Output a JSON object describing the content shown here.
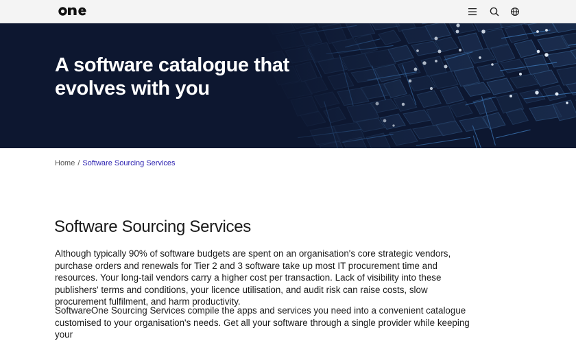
{
  "header": {
    "logo_text": "one",
    "icons": [
      "menu-icon",
      "search-icon",
      "globe-icon"
    ]
  },
  "hero": {
    "title": "A software catalogue that evolves with you"
  },
  "breadcrumb": {
    "home": "Home",
    "separator": "/",
    "current": "Software Sourcing Services"
  },
  "main": {
    "title": "Software Sourcing Services",
    "paragraphs": [
      "Although typically 90% of software budgets are spent on an organisation's core strategic vendors, purchase orders and renewals for Tier 2 and 3 software take up most IT procurement time and resources. Your long-tail vendors carry a higher cost per transaction. Lack of visibility into these publishers' terms and conditions, your licence utilisation, and audit risk can raise costs, slow procurement fulfilment, and harm productivity.",
      "SoftwareOne Sourcing Services compile the apps and services you need into a convenient catalogue customised to your organisation's needs. Get all your software through a single provider while keeping your"
    ]
  },
  "colors": {
    "hero_bg": "#0d1730",
    "breadcrumb_active": "#2a1fb0",
    "header_bg": "#f4f4f4"
  }
}
